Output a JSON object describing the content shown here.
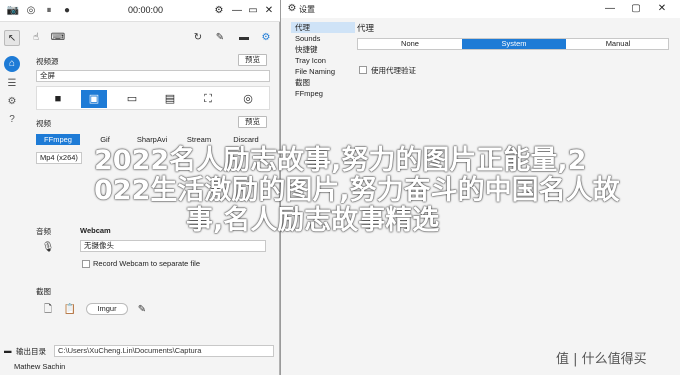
{
  "capture": {
    "timer": "00:00:00",
    "source_label": "视频源",
    "source_preset_button": "预览",
    "source_value": "全屏",
    "format_label": "视频",
    "format_preset_button": "预览",
    "formats": [
      "FFmpeg",
      "Gif",
      "SharpAvi",
      "Stream",
      "Discard"
    ],
    "codec_value": "Mp4 (x264)",
    "audio_label": "音频",
    "webcam_label": "Webcam",
    "webcam_value": "无摄像头",
    "record_webcam_label": "Record Webcam to separate file",
    "screenshot_label": "截图",
    "imgur_label": "Imgur",
    "output_label": "输出目录",
    "output_path": "C:\\Users\\XuCheng.Lin\\Documents\\Captura",
    "author": "Mathew Sachin"
  },
  "settings": {
    "title": "设置",
    "nav": [
      "代理",
      "Sounds",
      "快捷键",
      "Tray Icon",
      "File Naming",
      "截图",
      "FFmpeg"
    ],
    "heading": "代理",
    "proxy_tabs": [
      "None",
      "System",
      "Manual"
    ],
    "use_auth_label": "使用代理验证"
  },
  "overlay": {
    "lines": [
      "2022名人励志故事,努力的图片正能量,2",
      "022生活激励的图片,努力奋斗的中国名人故",
      "事,名人励志故事精选"
    ]
  },
  "watermark": "值 | 什么值得买"
}
